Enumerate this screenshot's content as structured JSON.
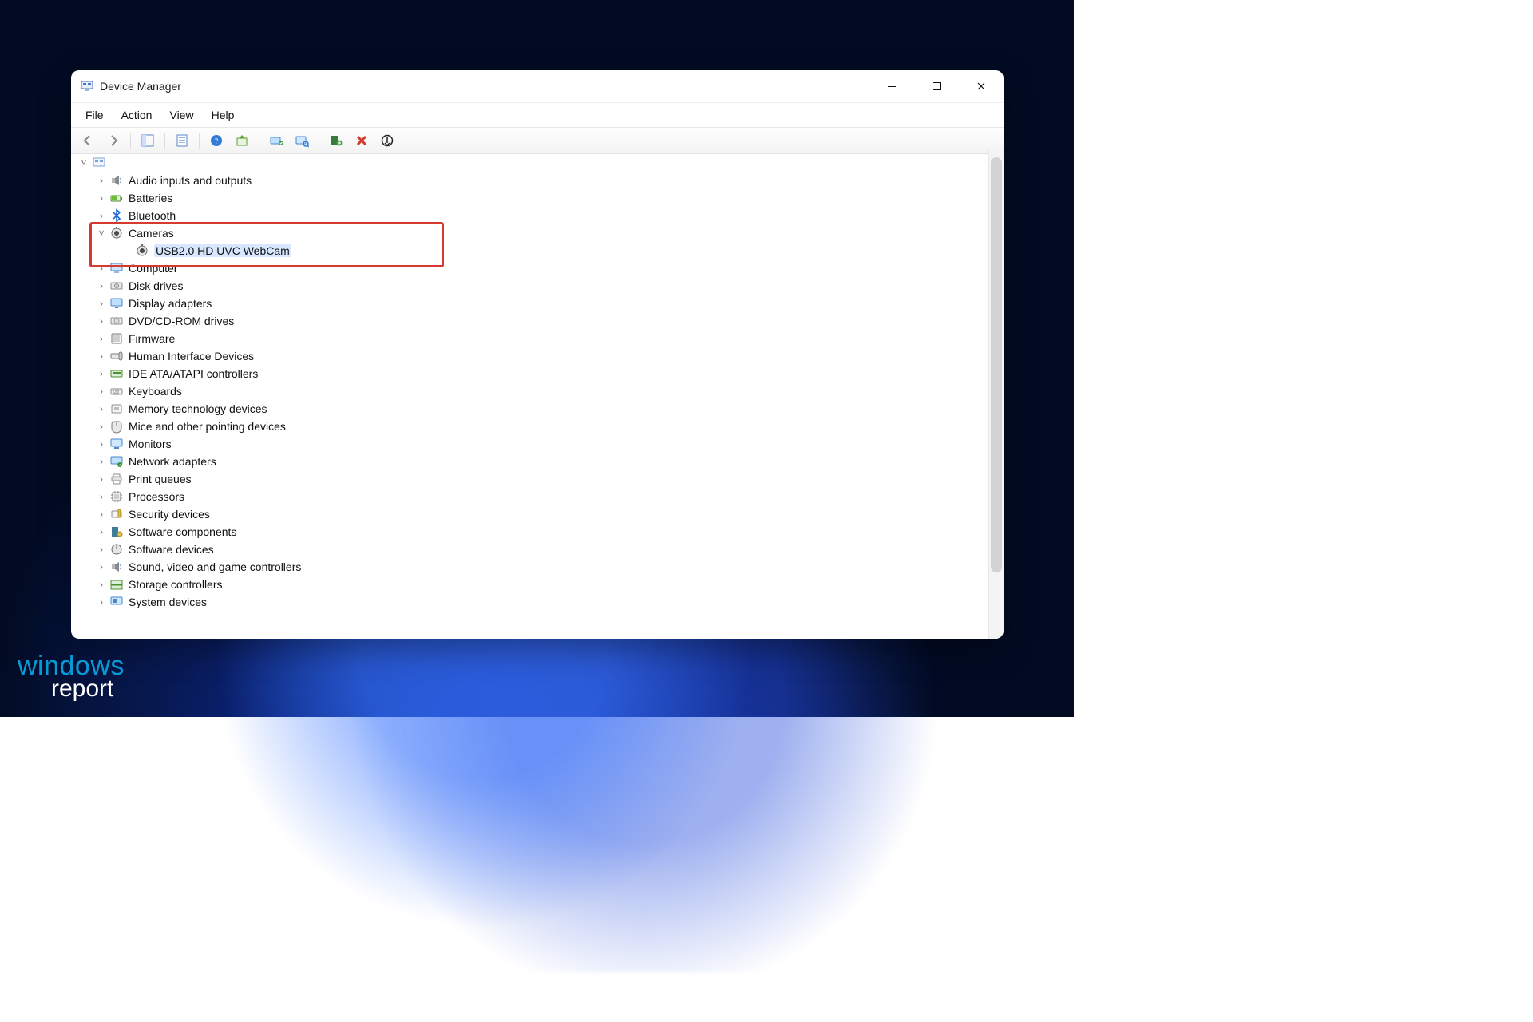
{
  "window": {
    "title": "Device Manager"
  },
  "menus": {
    "file": "File",
    "action": "Action",
    "view": "View",
    "help": "Help"
  },
  "brand": {
    "top": "windows",
    "bottom": "report"
  },
  "tree": {
    "root": {
      "label": ""
    },
    "categories": [
      {
        "label": "Audio inputs and outputs",
        "icon": "speaker"
      },
      {
        "label": "Batteries",
        "icon": "battery"
      },
      {
        "label": "Bluetooth",
        "icon": "bluetooth"
      },
      {
        "label": "Cameras",
        "icon": "camera",
        "expanded": true,
        "children": [
          {
            "label": "USB2.0 HD UVC WebCam",
            "icon": "camera",
            "selected": true
          }
        ]
      },
      {
        "label": "Computer",
        "icon": "computer"
      },
      {
        "label": "Disk drives",
        "icon": "disk"
      },
      {
        "label": "Display adapters",
        "icon": "display"
      },
      {
        "label": "DVD/CD-ROM drives",
        "icon": "optical"
      },
      {
        "label": "Firmware",
        "icon": "firmware"
      },
      {
        "label": "Human Interface Devices",
        "icon": "hid"
      },
      {
        "label": "IDE ATA/ATAPI controllers",
        "icon": "ide"
      },
      {
        "label": "Keyboards",
        "icon": "keyboard"
      },
      {
        "label": "Memory technology devices",
        "icon": "memory"
      },
      {
        "label": "Mice and other pointing devices",
        "icon": "mouse"
      },
      {
        "label": "Monitors",
        "icon": "monitor"
      },
      {
        "label": "Network adapters",
        "icon": "network"
      },
      {
        "label": "Print queues",
        "icon": "printer"
      },
      {
        "label": "Processors",
        "icon": "cpu"
      },
      {
        "label": "Security devices",
        "icon": "security"
      },
      {
        "label": "Software components",
        "icon": "softcomp"
      },
      {
        "label": "Software devices",
        "icon": "softdev"
      },
      {
        "label": "Sound, video and game controllers",
        "icon": "sound"
      },
      {
        "label": "Storage controllers",
        "icon": "storage"
      },
      {
        "label": "System devices",
        "icon": "system"
      }
    ]
  }
}
